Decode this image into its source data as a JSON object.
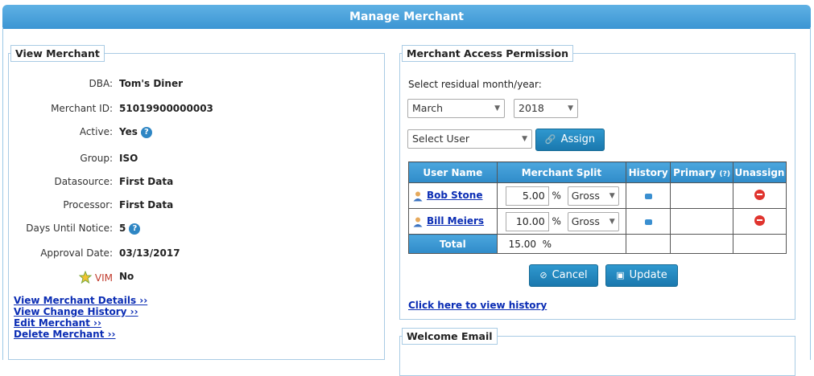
{
  "header": {
    "title": "Manage Merchant"
  },
  "view_merchant": {
    "legend": "View Merchant",
    "fields": [
      {
        "label": "DBA:",
        "value": "Tom's Diner"
      },
      {
        "label": "Merchant ID:",
        "value": "51019900000003"
      },
      {
        "label": "Active:",
        "value": "Yes"
      },
      {
        "label": "Group:",
        "value": "ISO"
      },
      {
        "label": "Datasource:",
        "value": "First Data"
      },
      {
        "label": "Processor:",
        "value": "First Data"
      },
      {
        "label": "Days Until Notice:",
        "value": "5"
      },
      {
        "label": "Approval Date:",
        "value": "03/13/2017"
      },
      {
        "label": "VIM",
        "value": "No"
      }
    ],
    "links": [
      "View Merchant Details ››",
      "View Change History ››",
      "Edit Merchant ››",
      "Delete Merchant ››"
    ]
  },
  "access": {
    "legend": "Merchant Access Permission",
    "prompt": "Select residual month/year:",
    "month": "March",
    "year": "2018",
    "user_select": "Select User",
    "assign_label": "Assign",
    "columns": [
      "User Name",
      "Merchant Split",
      "History",
      "Primary",
      "Unassign"
    ],
    "primary_help": "(?)",
    "rows": [
      {
        "name": "Bob Stone",
        "split": "5.00",
        "basis": "Gross"
      },
      {
        "name": "Bill Meiers",
        "split": "10.00",
        "basis": "Gross"
      }
    ],
    "percent": "%",
    "total_label": "Total",
    "total_value": "15.00  %",
    "cancel_label": "Cancel",
    "update_label": "Update",
    "history_link": "Click here to view history"
  },
  "welcome": {
    "legend": "Welcome Email"
  },
  "help_mark": "?"
}
